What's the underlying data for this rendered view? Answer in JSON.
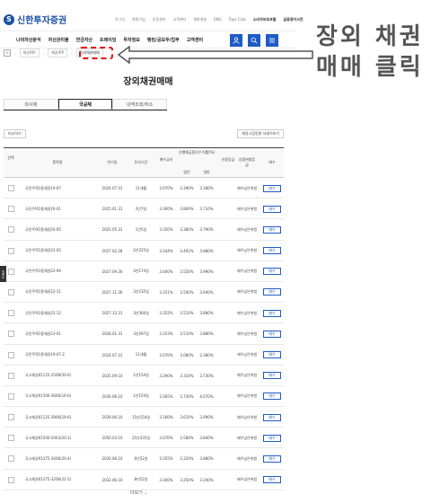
{
  "header": {
    "logo_symbol": "S",
    "logo_text": "신한투자증권",
    "utils": [
      "로그인",
      "회원가입",
      "인증센터",
      "고객센터",
      "계좌개설",
      "ENG",
      "Tops Club",
      "소비자보호포털",
      "금융용어사전"
    ]
  },
  "gnb": {
    "items": [
      "나의자산분석",
      "자산관리몰",
      "연금자산",
      "트레이딩",
      "투자정보",
      "뱅킹/공모주/업무",
      "고객센터"
    ],
    "icons": [
      "user-icon",
      "search-icon",
      "menu-icon"
    ]
  },
  "breadcrumb": {
    "items": [
      "채권/RP",
      "채권/RP"
    ],
    "current": "장외채권매매"
  },
  "page_title": "장외채권매매",
  "tabs": [
    "회사채",
    "국공채",
    "내역조회/취소"
  ],
  "active_tab": 1,
  "toolbar": {
    "compare": "비교하기",
    "right": "채권시장동향 자세히보기"
  },
  "table": {
    "headers": {
      "select": "선택",
      "name": "종목명",
      "maturity": "만기일",
      "period": "투자기간",
      "buy_rate": "매수금리",
      "after_tax_header": "은행예금환산수익률(%)",
      "after_tax_sub1": "법인",
      "after_tax_sub2": "일반",
      "credit": "신용등급",
      "grade": "상품위험등급",
      "buy": "매수"
    },
    "rows": [
      {
        "name": "국민주택1종채권19-07",
        "maturity": "2024.07.31",
        "period": "11개월",
        "buy_rate": "3.070%",
        "r1": "3.390%",
        "r2": "3.380%",
        "grade": "매우낮은위험",
        "buy": "매수"
      },
      {
        "name": "국민주택1종채권20-01",
        "maturity": "2025.01.31",
        "period": "2년7일",
        "buy_rate": "3.300%",
        "r1": "3.800%",
        "r2": "3.710%",
        "grade": "매우낮은위험",
        "buy": "매수"
      },
      {
        "name": "국민주택1종채권20-05",
        "maturity": "2025.05.31",
        "period": "1년5일",
        "buy_rate": "3.350%",
        "r1": "3.380%",
        "r2": "3.790%",
        "grade": "매우낮은위험",
        "buy": "매수"
      },
      {
        "name": "국민주택1종채권22-02",
        "maturity": "2027.02.28",
        "period": "2년225일",
        "buy_rate": "3.344%",
        "r1": "3.492%",
        "r2": "3.880%",
        "grade": "매우낮은위험",
        "buy": "매수"
      },
      {
        "name": "국민주택1종채권22-09",
        "maturity": "2027.09.30",
        "period": "3년174일",
        "buy_rate": "3.400%",
        "r1": "3.550%",
        "r2": "3.990%",
        "grade": "매우낮은위험",
        "buy": "매수"
      },
      {
        "name": "국민주택1종채권22-11",
        "maturity": "2027.11.30",
        "period": "3년235일",
        "buy_rate": "3.351%",
        "r1": "3.500%",
        "r2": "3.940%",
        "grade": "매우낮은위험",
        "buy": "매수"
      },
      {
        "name": "국민주택1종채권22-12",
        "maturity": "2027.12.31",
        "period": "3년366일",
        "buy_rate": "3.352%",
        "r1": "3.510%",
        "r2": "3.880%",
        "grade": "매우낮은위험",
        "buy": "매수"
      },
      {
        "name": "국민주택1종채권23-01",
        "maturity": "2028.01.31",
        "period": "3년297일",
        "buy_rate": "3.353%",
        "r1": "3.510%",
        "r2": "3.880%",
        "grade": "매우낮은위험",
        "buy": "매수"
      },
      {
        "name": "국민주택1종채권19-07-2",
        "maturity": "2024.07.31",
        "period": "11개월",
        "buy_rate": "3.070%",
        "r1": "3.080%",
        "r2": "3.380%",
        "grade": "매우낮은위험",
        "buy": "매수"
      },
      {
        "name": "국고채권01125-2509(20-6)",
        "maturity": "2025.09.10",
        "period": "1년154일",
        "buy_rate": "3.290%",
        "r1": "3.310%",
        "r2": "3.730%",
        "grade": "매우낮은위험",
        "buy": "매수"
      },
      {
        "name": "국고채권01500-3606(16-6)",
        "maturity": "2036.06.10",
        "period": "1년154일",
        "buy_rate": "3.365%",
        "r1": "3.730%",
        "r2": "4.070%",
        "grade": "매우낮은위험",
        "buy": "매수"
      },
      {
        "name": "국고채권01125-3906(19-6)",
        "maturity": "2039.06.10",
        "period": "15년154일",
        "buy_rate": "3.160%",
        "r1": "3.610%",
        "r2": "3.990%",
        "grade": "매우낮은위험",
        "buy": "매수"
      },
      {
        "name": "국고채권01500-5003(20-2)",
        "maturity": "2050.03.10",
        "period": "25년335일",
        "buy_rate": "3.070%",
        "r1": "3.580%",
        "r2": "3.840%",
        "grade": "매우낮은위험",
        "buy": "매수"
      },
      {
        "name": "국고채권01375-3006(20-4)",
        "maturity": "2030.06.10",
        "period": "6년52일",
        "buy_rate": "3.355%",
        "r1": "3.320%",
        "r2": "3.880%",
        "grade": "매우낮은위험",
        "buy": "매수"
      },
      {
        "name": "국고채권01375-3206(22-5)",
        "maturity": "2032.06.10",
        "period": "8년52일",
        "buy_rate": "3.300%",
        "r1": "3.250%",
        "r2": "3.240%",
        "grade": "매우낮은위험",
        "buy": "매수"
      }
    ]
  },
  "more_label": "더보기",
  "side_tab_label": "퀵메뉴",
  "annotation": {
    "line1": "장외 채권",
    "line2": "매매 클릭"
  },
  "colors": {
    "brand": "#1b4fa3",
    "accent": "#1f5bc4",
    "highlight": "#e01818"
  }
}
